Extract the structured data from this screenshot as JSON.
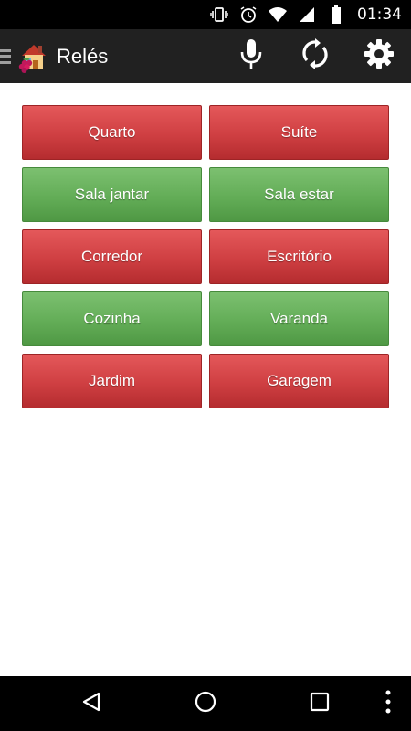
{
  "status_bar": {
    "time": "01:34",
    "icons": [
      "vibrate-icon",
      "alarm-icon",
      "wifi-icon",
      "signal-icon",
      "battery-icon"
    ]
  },
  "action_bar": {
    "title": "Relés",
    "actions": [
      "microphone-icon",
      "sync-icon",
      "settings-icon"
    ]
  },
  "relays": [
    {
      "label": "Quarto",
      "state": "off"
    },
    {
      "label": "Suíte",
      "state": "off"
    },
    {
      "label": "Sala jantar",
      "state": "on"
    },
    {
      "label": "Sala estar",
      "state": "on"
    },
    {
      "label": "Corredor",
      "state": "off"
    },
    {
      "label": "Escritório",
      "state": "off"
    },
    {
      "label": "Cozinha",
      "state": "on"
    },
    {
      "label": "Varanda",
      "state": "on"
    },
    {
      "label": "Jardim",
      "state": "off"
    },
    {
      "label": "Garagem",
      "state": "off"
    }
  ],
  "colors": {
    "relay_off": "#cf3f42",
    "relay_on": "#63ad57",
    "action_bar": "#212121",
    "status_bar": "#000000"
  },
  "nav_bar": {
    "buttons": [
      "back-icon",
      "home-icon",
      "recents-icon",
      "overflow-menu-icon"
    ]
  }
}
